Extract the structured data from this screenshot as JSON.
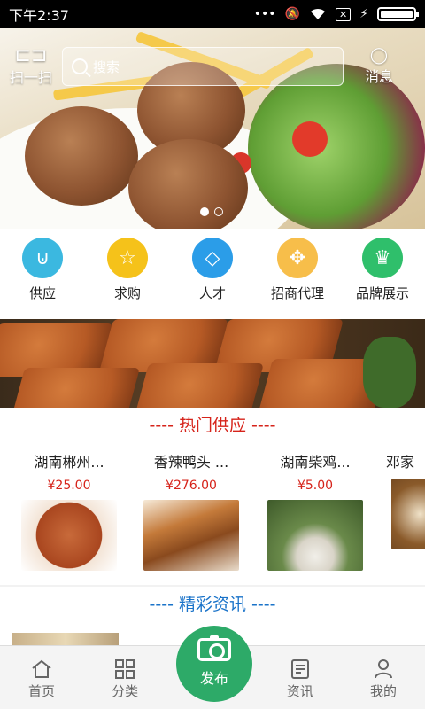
{
  "status_bar": {
    "time": "下午2:37",
    "icons": [
      "more-dots-icon",
      "mute-icon",
      "wifi-icon",
      "no-sim-icon",
      "charging-icon",
      "battery-icon"
    ],
    "battery_level": 1.0
  },
  "header": {
    "scan_label": "扫一扫",
    "search_placeholder": "搜索",
    "message_label": "消息"
  },
  "banner": {
    "slide_count": 2,
    "active_slide": 1
  },
  "categories": [
    {
      "label": "供应",
      "icon": "supply-icon",
      "color": "#3bb8e0"
    },
    {
      "label": "求购",
      "icon": "star-icon",
      "color": "#f5c21a"
    },
    {
      "label": "人才",
      "icon": "diamond-icon",
      "color": "#2b9de8"
    },
    {
      "label": "招商代理",
      "icon": "arrows-icon",
      "color": "#f7be4a"
    },
    {
      "label": "品牌展示",
      "icon": "crown-icon",
      "color": "#2fbf6b"
    }
  ],
  "hot_supply": {
    "title": "----  热门供应  ----",
    "items": [
      {
        "name": "湖南郴州...",
        "price": "¥25.00"
      },
      {
        "name": "香辣鸭头 ...",
        "price": "¥276.00"
      },
      {
        "name": "湖南柴鸡...",
        "price": "¥5.00"
      },
      {
        "name": "邓家",
        "price": ""
      }
    ]
  },
  "news": {
    "title": "----  精彩资讯  ----"
  },
  "tabbar": {
    "items": [
      {
        "label": "首页",
        "icon": "home-icon"
      },
      {
        "label": "分类",
        "icon": "grid-icon"
      },
      {
        "label": "资讯",
        "icon": "news-icon"
      },
      {
        "label": "我的",
        "icon": "user-icon"
      }
    ],
    "publish_label": "发布"
  },
  "colors": {
    "accent_red": "#d6231a",
    "accent_blue": "#1a73c9",
    "publish_green": "#2daa68"
  }
}
